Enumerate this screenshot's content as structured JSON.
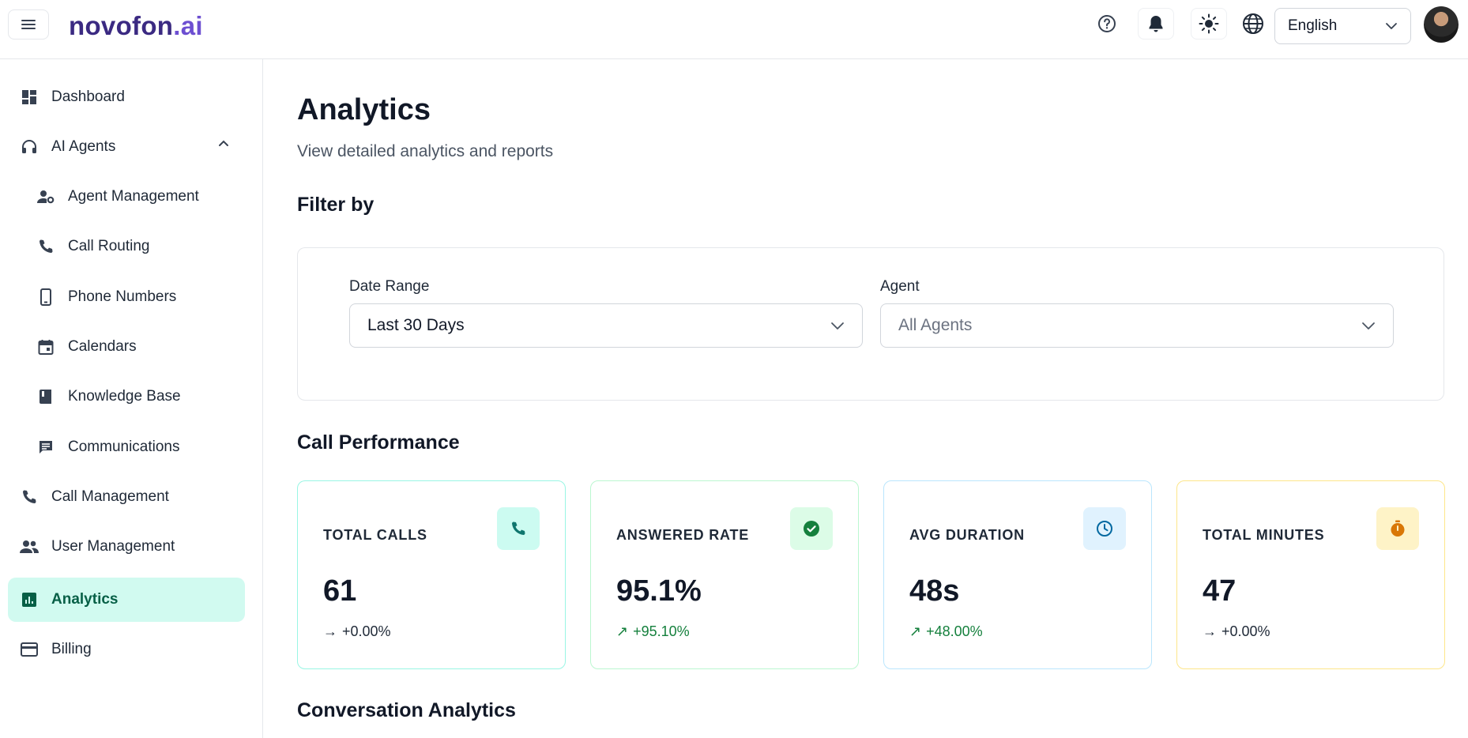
{
  "brand": {
    "name_main": "novofon",
    "name_suffix": ".ai"
  },
  "header": {
    "language": {
      "selected": "English"
    }
  },
  "sidebar": {
    "items": [
      {
        "label": "Dashboard",
        "icon": "dashboard-icon"
      },
      {
        "label": "AI Agents",
        "icon": "headset-icon",
        "expanded": true
      },
      {
        "label": "Agent Management",
        "icon": "agent-settings-icon"
      },
      {
        "label": "Call Routing",
        "icon": "phone-icon"
      },
      {
        "label": "Phone Numbers",
        "icon": "mobile-icon"
      },
      {
        "label": "Calendars",
        "icon": "calendar-icon"
      },
      {
        "label": "Knowledge Base",
        "icon": "book-icon"
      },
      {
        "label": "Communications",
        "icon": "chat-icon"
      },
      {
        "label": "Call Management",
        "icon": "phone-icon"
      },
      {
        "label": "User Management",
        "icon": "users-icon"
      },
      {
        "label": "Analytics",
        "icon": "analytics-icon",
        "active": true
      },
      {
        "label": "Billing",
        "icon": "credit-card-icon"
      }
    ]
  },
  "page": {
    "title": "Analytics",
    "subtitle": "View detailed analytics and reports"
  },
  "filters": {
    "section_title": "Filter by",
    "date_range": {
      "label": "Date Range",
      "value": "Last 30 Days"
    },
    "agent": {
      "label": "Agent",
      "placeholder": "All Agents"
    }
  },
  "call_performance": {
    "section_title": "Call Performance",
    "stats": [
      {
        "label": "TOTAL CALLS",
        "value": "61",
        "change": "+0.00%",
        "trend": "flat",
        "accent": "#99f6e4",
        "icon_bg": "#ccfbf1",
        "icon_color": "#0f766e",
        "icon": "phone-icon"
      },
      {
        "label": "ANSWERED RATE",
        "value": "95.1%",
        "change": "+95.10%",
        "trend": "up",
        "accent": "#bbf7d0",
        "icon_bg": "#dcfce7",
        "icon_color": "#15803d",
        "icon": "check-circle-icon"
      },
      {
        "label": "AVG DURATION",
        "value": "48s",
        "change": "+48.00%",
        "trend": "up",
        "accent": "#bae6fd",
        "icon_bg": "#e0f2fe",
        "icon_color": "#0369a1",
        "icon": "clock-icon"
      },
      {
        "label": "TOTAL MINUTES",
        "value": "47",
        "change": "+0.00%",
        "trend": "flat",
        "accent": "#fde68a",
        "icon_bg": "#fef3c7",
        "icon_color": "#d97706",
        "icon": "timer-icon"
      }
    ]
  },
  "conversation_analytics": {
    "section_title": "Conversation Analytics"
  },
  "arrows": {
    "flat": "→",
    "up": "↗"
  }
}
